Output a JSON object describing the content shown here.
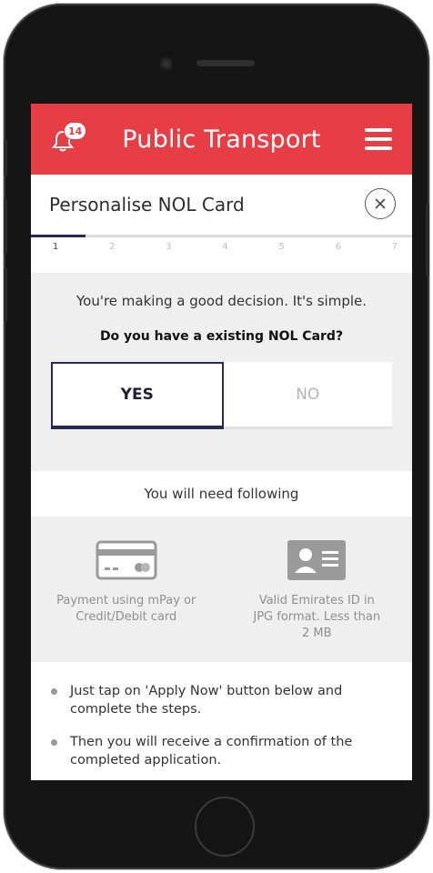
{
  "header": {
    "title": "Public Transport",
    "notification_count": "14",
    "accent_color": "#e63e44",
    "bell_icon": "bell-icon",
    "menu_icon": "hamburger-menu-icon"
  },
  "page": {
    "title": "Personalise NOL Card",
    "close_icon": "close-icon"
  },
  "steps": {
    "labels": [
      "1",
      "2",
      "3",
      "4",
      "5",
      "6",
      "7"
    ],
    "current": 1,
    "progress_fraction": 0.143
  },
  "question_panel": {
    "intro": "You're making a good decision. It's simple.",
    "question": "Do you have a existing NOL Card?",
    "options": {
      "yes": "YES",
      "no": "NO"
    },
    "selected": "YES"
  },
  "requirements": {
    "title": "You will need following",
    "items": [
      {
        "icon": "credit-card-icon",
        "text": "Payment using mPay or Credit/Debit card"
      },
      {
        "icon": "id-card-icon",
        "text": "Valid Emirates ID in JPG format. Less than 2 MB"
      }
    ]
  },
  "instructions": [
    "Just tap on 'Apply Now' button below and complete the steps.",
    "Then you will receive a confirmation of the completed application."
  ]
}
